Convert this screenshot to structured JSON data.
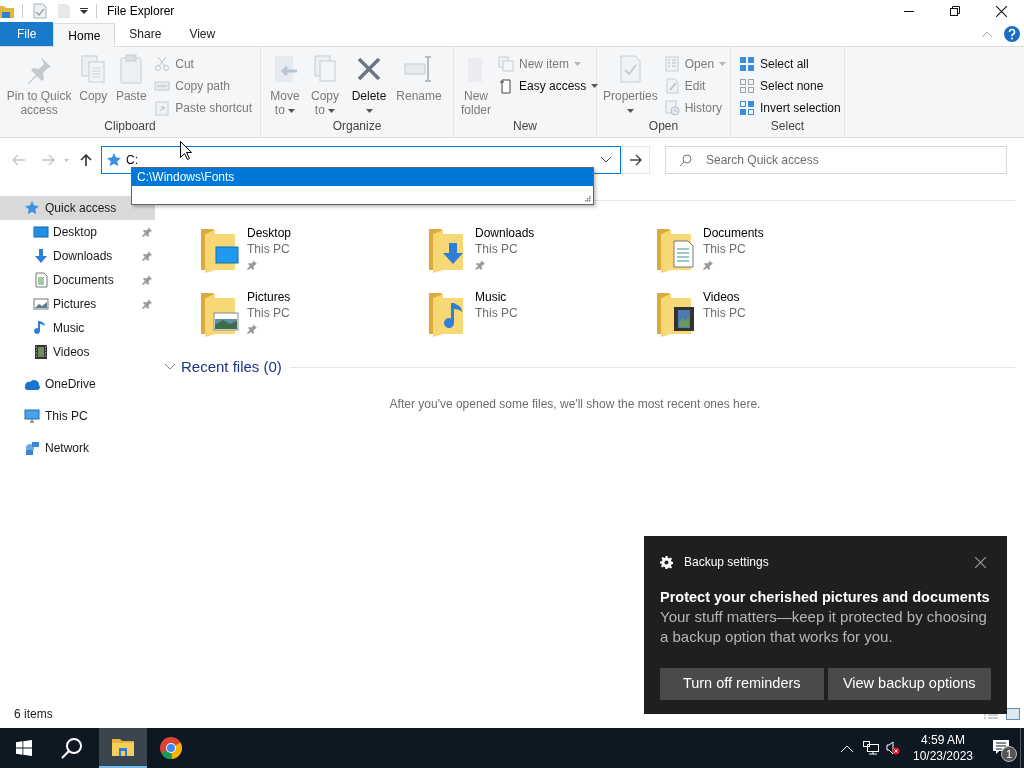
{
  "window": {
    "title": "File Explorer"
  },
  "tabs": [
    {
      "label": "File",
      "kind": "file",
      "selected": false
    },
    {
      "label": "Home",
      "kind": "tab",
      "selected": true
    },
    {
      "label": "Share",
      "kind": "tab",
      "selected": false
    },
    {
      "label": "View",
      "kind": "tab",
      "selected": false
    }
  ],
  "ribbon": {
    "groups": [
      {
        "label": "Clipboard",
        "columns": [
          {
            "kind": "large",
            "label": "Pin to Quick access",
            "disabled": true,
            "dropdown": false
          },
          {
            "kind": "large",
            "label": "Copy",
            "disabled": true,
            "dropdown": false
          },
          {
            "kind": "large",
            "label": "Paste",
            "disabled": true,
            "dropdown": false
          },
          {
            "kind": "stack",
            "items": [
              {
                "label": "Cut",
                "disabled": true,
                "dropdown": false
              },
              {
                "label": "Copy path",
                "disabled": true,
                "dropdown": false
              },
              {
                "label": "Paste shortcut",
                "disabled": true,
                "dropdown": false
              }
            ]
          }
        ]
      },
      {
        "label": "Organize",
        "columns": [
          {
            "kind": "large",
            "label": "Move to",
            "disabled": true,
            "dropdown": true
          },
          {
            "kind": "large",
            "label": "Copy to",
            "disabled": true,
            "dropdown": true
          },
          {
            "kind": "large",
            "label": "Delete",
            "disabled": false,
            "dropdown": true
          },
          {
            "kind": "large",
            "label": "Rename",
            "disabled": true,
            "dropdown": false
          }
        ]
      },
      {
        "label": "New",
        "columns": [
          {
            "kind": "large",
            "label": "New folder",
            "disabled": true,
            "dropdown": false
          },
          {
            "kind": "stack",
            "items": [
              {
                "label": "New item",
                "disabled": true,
                "dropdown": true
              },
              {
                "label": "Easy access",
                "disabled": false,
                "dropdown": true
              }
            ]
          }
        ]
      },
      {
        "label": "Open",
        "columns": [
          {
            "kind": "large",
            "label": "Properties",
            "disabled": true,
            "dropdown": true
          },
          {
            "kind": "stack",
            "items": [
              {
                "label": "Open",
                "disabled": true,
                "dropdown": true
              },
              {
                "label": "Edit",
                "disabled": true,
                "dropdown": false
              },
              {
                "label": "History",
                "disabled": true,
                "dropdown": false
              }
            ]
          }
        ]
      },
      {
        "label": "Select",
        "columns": [
          {
            "kind": "stack",
            "items": [
              {
                "label": "Select all",
                "disabled": false,
                "dropdown": false
              },
              {
                "label": "Select none",
                "disabled": false,
                "dropdown": false
              },
              {
                "label": "Invert selection",
                "disabled": false,
                "dropdown": false
              }
            ]
          }
        ]
      }
    ]
  },
  "address": {
    "value": "C:",
    "suggestions": [
      {
        "label": "C:\\Windows\\Fonts",
        "selected": true
      }
    ]
  },
  "search": {
    "placeholder": "Search Quick access"
  },
  "nav": [
    {
      "label": "Quick access",
      "selected": true,
      "children": [
        {
          "label": "Desktop",
          "pinned": true,
          "selected": false
        },
        {
          "label": "Downloads",
          "pinned": true,
          "selected": false
        },
        {
          "label": "Documents",
          "pinned": true,
          "selected": false
        },
        {
          "label": "Pictures",
          "pinned": true,
          "selected": false
        },
        {
          "label": "Music",
          "pinned": false,
          "selected": false
        },
        {
          "label": "Videos",
          "pinned": false,
          "selected": false
        }
      ]
    },
    {
      "label": "OneDrive",
      "selected": false
    },
    {
      "label": "This PC",
      "selected": false
    },
    {
      "label": "Network",
      "selected": false
    }
  ],
  "folders": [
    {
      "name": "Desktop",
      "location": "This PC",
      "pinned": true
    },
    {
      "name": "Downloads",
      "location": "This PC",
      "pinned": true
    },
    {
      "name": "Documents",
      "location": "This PC",
      "pinned": true
    },
    {
      "name": "Pictures",
      "location": "This PC",
      "pinned": true
    },
    {
      "name": "Music",
      "location": "This PC",
      "pinned": false
    },
    {
      "name": "Videos",
      "location": "This PC",
      "pinned": false
    }
  ],
  "recent": {
    "title": "Recent files (0)",
    "expanded": true,
    "message": "After you've opened some files, we'll show the most recent ones here."
  },
  "status_bar": {
    "item_count": "6 items"
  },
  "notification": {
    "app": "Backup settings",
    "title": "Protect your cherished pictures and documents",
    "body": "Your stuff matters—keep it protected by choosing a backup option that works for you.",
    "buttons": [
      "Turn off reminders",
      "View backup options"
    ]
  },
  "taskbar": {
    "apps": [
      {
        "selected": true
      },
      {
        "selected": false
      }
    ],
    "time": "4:59 AM",
    "date": "10/23/2023",
    "notification_count": "1"
  }
}
